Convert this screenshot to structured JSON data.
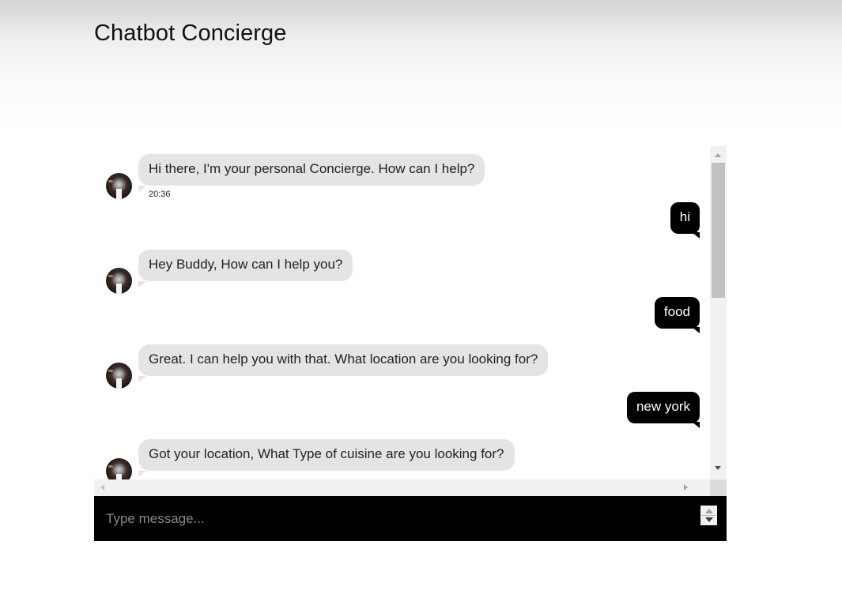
{
  "header": {
    "title": "Chatbot Concierge"
  },
  "conversation": {
    "messages": [
      {
        "sender": "bot",
        "text": "Hi there, I'm your personal Concierge. How can I help?",
        "time": "20:36",
        "avatar": "concierge-avatar"
      },
      {
        "sender": "user",
        "text": "hi"
      },
      {
        "sender": "bot",
        "text": "Hey Buddy, How can I help you?",
        "avatar": "concierge-avatar"
      },
      {
        "sender": "user",
        "text": "food"
      },
      {
        "sender": "bot",
        "text": "Great. I can help you with that. What location are you looking for?",
        "avatar": "concierge-avatar"
      },
      {
        "sender": "user",
        "text": "new york"
      },
      {
        "sender": "bot",
        "text": "Got your location, What Type of cuisine are you looking for?",
        "avatar": "concierge-avatar"
      }
    ]
  },
  "composer": {
    "placeholder": "Type message...",
    "value": ""
  },
  "colors": {
    "bot_bubble": "#e4e4e4",
    "user_bubble": "#000000",
    "composer_bg": "#000000"
  }
}
